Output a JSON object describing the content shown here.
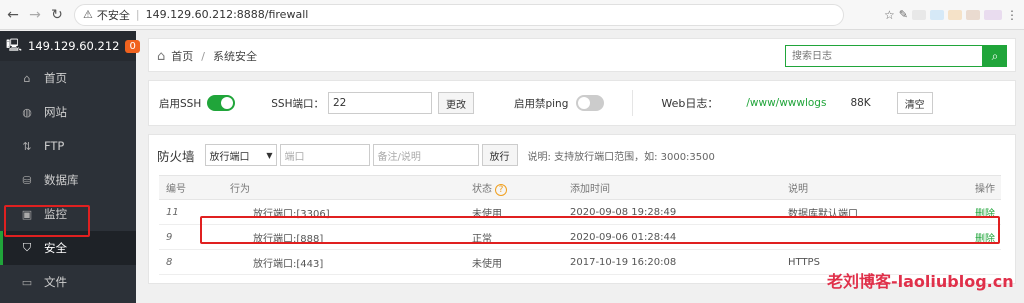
{
  "browser": {
    "security_label": "不安全",
    "url": "149.129.60.212:8888/firewall"
  },
  "sidebar": {
    "host": "149.129.60.212",
    "badge": "0",
    "items": [
      {
        "label": "首页",
        "icon": "home-icon"
      },
      {
        "label": "网站",
        "icon": "globe-icon"
      },
      {
        "label": "FTP",
        "icon": "ftp-icon"
      },
      {
        "label": "数据库",
        "icon": "database-icon"
      },
      {
        "label": "监控",
        "icon": "monitor-icon"
      },
      {
        "label": "安全",
        "icon": "shield-icon"
      },
      {
        "label": "文件",
        "icon": "folder-icon"
      }
    ]
  },
  "breadcrumb": {
    "home": "首页",
    "sep": "/",
    "current": "系统安全"
  },
  "search": {
    "placeholder": "搜索日志"
  },
  "settings": {
    "ssh_label": "启用SSH",
    "ssh_port_label": "SSH端口：",
    "ssh_port_value": "22",
    "change_button": "更改",
    "ping_label": "启用禁ping",
    "weblog_label": "Web日志：",
    "weblog_path": "/www/wwwlogs",
    "weblog_size": "88K",
    "clear_button": "清空"
  },
  "firewall": {
    "title": "防火墙",
    "select_value": "放行端口",
    "port_placeholder": "端口",
    "note_placeholder": "备注/说明",
    "allow_button": "放行",
    "hint": "说明: 支持放行端口范围，如: 3000:3500",
    "columns": [
      "编号",
      "行为",
      "状态",
      "添加时间",
      "说明",
      "操作"
    ],
    "rows": [
      {
        "id": "11",
        "action": "放行端口:[3306]",
        "status": "未使用",
        "time": "2020-09-08 19:28:49",
        "note": "数据库默认端口",
        "op": "删除"
      },
      {
        "id": "9",
        "action": "放行端口:[888]",
        "status": "正常",
        "time": "2020-09-06 01:28:44",
        "note": "",
        "op": "删除"
      },
      {
        "id": "8",
        "action": "放行端口:[443]",
        "status": "未使用",
        "time": "2017-10-19 16:20:08",
        "note": "HTTPS",
        "op": ""
      }
    ]
  },
  "watermark": "老刘博客-laoliublog.cn",
  "colors": {
    "accent": "#20a53a",
    "highlight": "#e02020",
    "sidebar": "#2c3138"
  }
}
